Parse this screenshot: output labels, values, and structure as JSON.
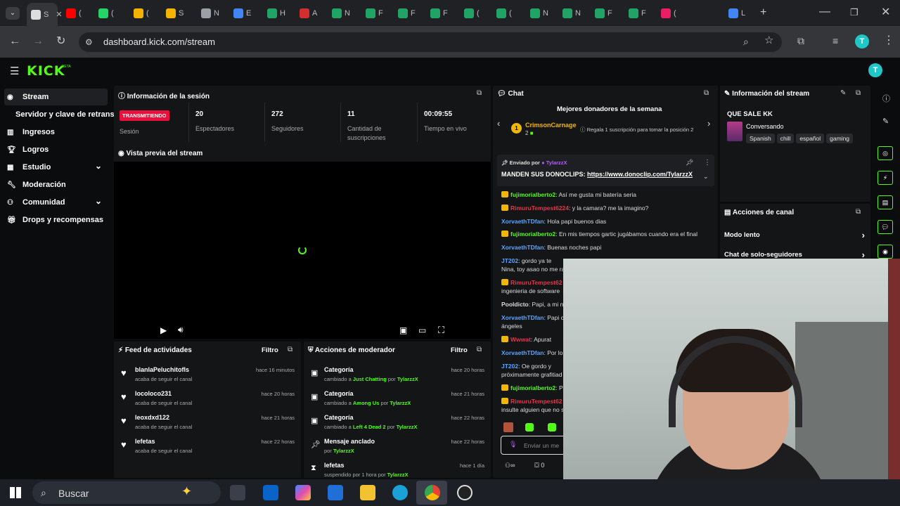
{
  "browser": {
    "tabs": [
      "S",
      "(",
      "(",
      "(",
      "S",
      "N",
      "E",
      "H",
      "A",
      "N",
      "F",
      "F",
      "F",
      "(",
      "(",
      "N",
      "N",
      "F",
      "F",
      "(",
      "L"
    ],
    "tab_colors": [
      "#dddddd",
      "#ff0000",
      "#25d366",
      "#f4b400",
      "#f4b400",
      "#9aa0a6",
      "#4285f4",
      "#21a366",
      "#d32f2f",
      "#21a366",
      "#21a366",
      "#21a366",
      "#21a366",
      "#21a366",
      "#21a366",
      "#21a366",
      "#21a366",
      "#21a366",
      "#21a366",
      "#e91e63",
      "#4285f4"
    ],
    "url": "dashboard.kick.com/stream",
    "avatar_letter": "T"
  },
  "app": {
    "logo": "KICK",
    "beta": "BETA"
  },
  "sidebar": {
    "items": [
      {
        "label": "Stream",
        "icon": "stream-icon"
      },
      {
        "label": "Servidor y clave de retransm",
        "icon": ""
      },
      {
        "label": "Ingresos",
        "icon": "revenue-icon"
      },
      {
        "label": "Logros",
        "icon": "trophy-icon"
      },
      {
        "label": "Estudio",
        "icon": "studio-icon"
      },
      {
        "label": "Moderación",
        "icon": "wrench-icon"
      },
      {
        "label": "Comunidad",
        "icon": "people-icon"
      },
      {
        "label": "Drops y recompensas",
        "icon": "gift-icon"
      }
    ]
  },
  "session": {
    "title": "Información de la sesión",
    "badge": "TRANSMITIENDO",
    "badge_label": "Sesión",
    "stats": [
      {
        "value": "20",
        "label": "Espectadores"
      },
      {
        "value": "272",
        "label": "Seguidores"
      },
      {
        "value": "11",
        "label": "Cantidad de suscripciones"
      },
      {
        "value": "00:09:55",
        "label": "Tiempo en vivo"
      }
    ]
  },
  "preview": {
    "title": "Vista previa del stream"
  },
  "activity": {
    "title": "Feed de actividades",
    "filter": "Filtro",
    "rows": [
      {
        "user": "blanlaPeluchitofls",
        "text": "acaba de seguir el canal",
        "time": "hace 16 minutos"
      },
      {
        "user": "locoloco231",
        "text": "acaba de seguir el canal",
        "time": "hace 20 horas"
      },
      {
        "user": "leoxdxd122",
        "text": "acaba de seguir el canal",
        "time": "hace 21 horas"
      },
      {
        "user": "lefetas",
        "text": "acaba de seguir el canal",
        "time": "hace 22 horas"
      }
    ]
  },
  "modactions": {
    "title": "Acciones de moderador",
    "filter": "Filtro",
    "rows": [
      {
        "title": "Categoría",
        "pre": "cambiado a",
        "target": "Just Chatting",
        "by": "por",
        "user": "TylarzzX",
        "time": "hace 20 horas"
      },
      {
        "title": "Categoría",
        "pre": "cambiado a",
        "target": "Among Us",
        "by": "por",
        "user": "TylarzzX",
        "time": "hace 21 horas"
      },
      {
        "title": "Categoría",
        "pre": "cambiado a",
        "target": "Left 4 Dead 2",
        "by": "por",
        "user": "TylarzzX",
        "time": "hace 22 horas"
      },
      {
        "title": "Mensaje anclado",
        "pre": "por",
        "target": "TylarzzX",
        "by": "",
        "user": "",
        "time": "hace 22 horas"
      },
      {
        "title": "lefetas",
        "pre": "suspendido por 1 hora por",
        "target": "TylarzzX",
        "by": "",
        "user": "",
        "time": "hace 1 día"
      }
    ]
  },
  "chat": {
    "title": "Chat",
    "donors_title": "Mejores donadores de la semana",
    "top_donor": "CrimsonCarnage",
    "top_donor_count": "2",
    "gift_hint": "Regala 1 suscripción para tomar la posición 2",
    "pinned_by_label": "Enviado por",
    "pinned_by": "TylarzzX",
    "pinned_text": "MANDEN SUS DONOCLIPS:",
    "pinned_link": "https://www.donoclip.com/TylarzzX",
    "messages": [
      {
        "user": "fujimorialberto2",
        "color": "#53fc18",
        "text": ": Así me gusta mi batería seria"
      },
      {
        "user": "RimuruTempest6224",
        "color": "#e5354a",
        "text": ": y la camara? me la imagino?"
      },
      {
        "user": "XorvaethTDfan",
        "color": "#5ba4ff",
        "text": ": Hola papi buenos dias"
      },
      {
        "user": "fujimorialberto2",
        "color": "#53fc18",
        "text": ": En mis tiempos gartic jugábamos cuando era el final"
      },
      {
        "user": "XorvaethTDfan",
        "color": "#5ba4ff",
        "text": ": Buenas noches papi"
      },
      {
        "user": "JT202",
        "color": "#5ba4ff",
        "text": ": gordo ya te"
      },
      {
        "user": "",
        "color": "#ddd",
        "text": "Nina, toy asao no me ra"
      },
      {
        "user": "RimuruTempest62",
        "color": "#e5354a",
        "text": ""
      },
      {
        "user": "",
        "color": "#ddd",
        "text": "ingenieria de software"
      },
      {
        "user": "Pooldicto",
        "color": "#ddd",
        "text": ": Papi, a mi ne"
      },
      {
        "user": "XorvaethTDfan",
        "color": "#5ba4ff",
        "text": ": Papi c"
      },
      {
        "user": "",
        "color": "#ddd",
        "text": "ángeles"
      },
      {
        "user": "Wwwat",
        "color": "#e5354a",
        "text": ": Apurat"
      },
      {
        "user": "XorvaethTDfan",
        "color": "#5ba4ff",
        "text": ": Por lo"
      },
      {
        "user": "JT202",
        "color": "#5ba4ff",
        "text": ": Oe gordo y"
      },
      {
        "user": "",
        "color": "#ddd",
        "text": "próximamente grafitiad"
      },
      {
        "user": "fujimorialberto2",
        "color": "#53fc18",
        "text": ": P"
      },
      {
        "user": "RimuruTempest62",
        "color": "#e5354a",
        "text": ""
      },
      {
        "user": "",
        "color": "#ddd",
        "text": "insulte alguien que no s"
      }
    ],
    "input_placeholder": "Enviar un me",
    "footer_count": "0"
  },
  "streaminfo": {
    "title": "Información del stream",
    "stream_title": "QUE SALE KK",
    "category": "Conversando",
    "tags": [
      "Spanish",
      "chill",
      "español",
      "gaming"
    ]
  },
  "channel_actions": {
    "title": "Acciones de canal",
    "items": [
      "Modo lento",
      "Chat de solo-seguidores"
    ]
  },
  "taskbar": {
    "search": "Buscar"
  }
}
